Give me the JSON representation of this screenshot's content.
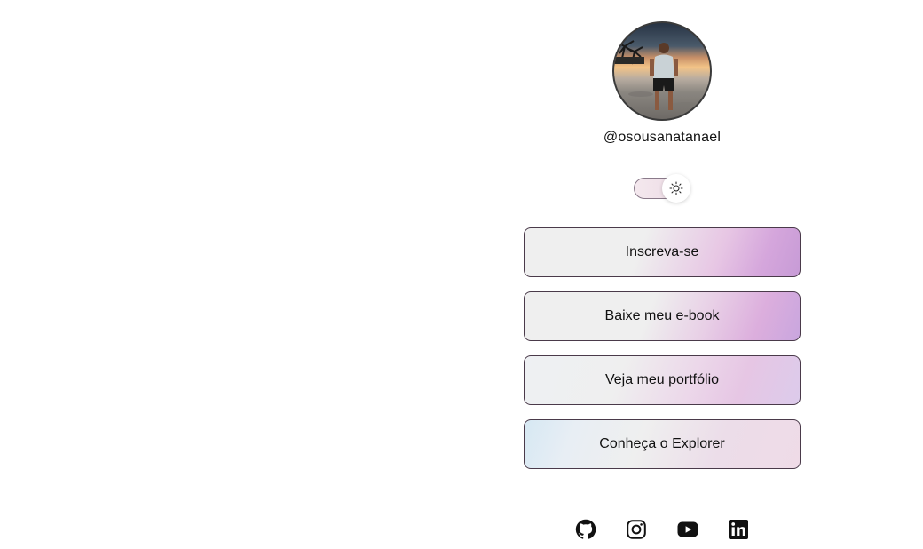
{
  "profile": {
    "username": "@osousanatanael"
  },
  "theme_switch": {
    "icon": "sun-icon",
    "state": "light"
  },
  "links": [
    {
      "label": "Inscreva-se"
    },
    {
      "label": "Baixe meu e-book"
    },
    {
      "label": "Veja meu portfólio"
    },
    {
      "label": "Conheça o Explorer"
    }
  ],
  "social": [
    {
      "icon": "github-icon"
    },
    {
      "icon": "instagram-icon"
    },
    {
      "icon": "youtube-icon"
    },
    {
      "icon": "linkedin-icon"
    }
  ],
  "colors": {
    "text": "#111111",
    "border": "#4a3a4a",
    "accent": "#c79bd6"
  }
}
